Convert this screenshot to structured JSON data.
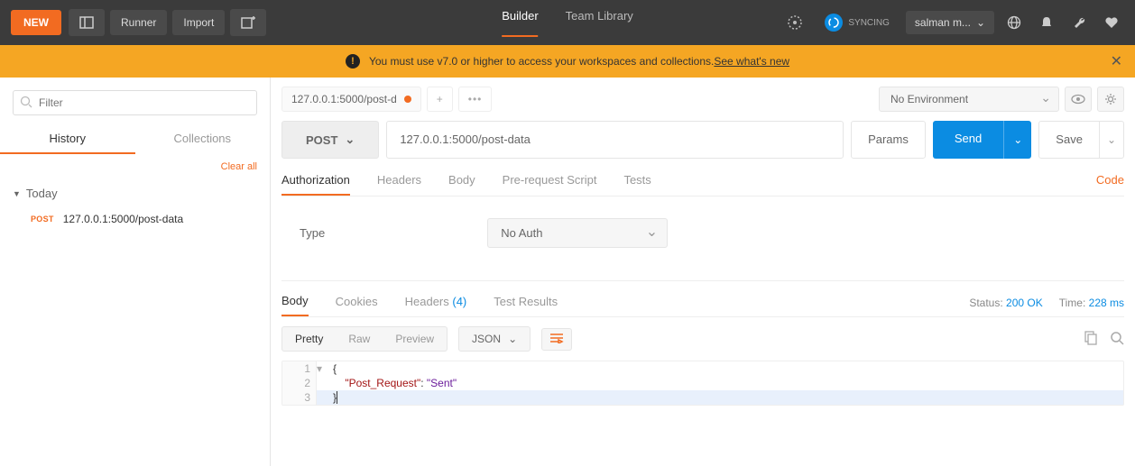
{
  "topbar": {
    "new_label": "NEW",
    "runner_label": "Runner",
    "import_label": "Import",
    "builder_label": "Builder",
    "team_library_label": "Team Library",
    "syncing_label": "SYNCING",
    "user_label": "salman m..."
  },
  "warning": {
    "text": "You must use v7.0 or higher to access your workspaces and collections. ",
    "link": "See what's new"
  },
  "sidebar": {
    "filter_placeholder": "Filter",
    "tabs": {
      "history": "History",
      "collections": "Collections"
    },
    "clear_all": "Clear all",
    "group": "Today",
    "item": {
      "method": "POST",
      "url": "127.0.0.1:5000/post-data"
    }
  },
  "content": {
    "tab_label": "127.0.0.1:5000/post-d",
    "env": "No Environment",
    "method": "POST",
    "url": "127.0.0.1:5000/post-data",
    "params_label": "Params",
    "send_label": "Send",
    "save_label": "Save",
    "req_tabs": {
      "auth": "Authorization",
      "headers": "Headers",
      "body": "Body",
      "prereq": "Pre-request Script",
      "tests": "Tests",
      "code": "Code"
    },
    "auth": {
      "type_label": "Type",
      "type_value": "No Auth"
    },
    "resp_tabs": {
      "body": "Body",
      "cookies": "Cookies",
      "headers": "Headers",
      "headers_count": "(4)",
      "tests": "Test Results"
    },
    "status": {
      "label": "Status:",
      "value": "200 OK"
    },
    "time": {
      "label": "Time:",
      "value": "228 ms"
    },
    "modes": {
      "pretty": "Pretty",
      "raw": "Raw",
      "preview": "Preview",
      "lang": "JSON"
    },
    "code": {
      "l1_num": "1",
      "l1_txt": "{",
      "l2_num": "2",
      "l2_key": "\"Post_Request\"",
      "l2_sep": ": ",
      "l2_val": "\"Sent\"",
      "l3_num": "3",
      "l3_txt": "}"
    }
  }
}
